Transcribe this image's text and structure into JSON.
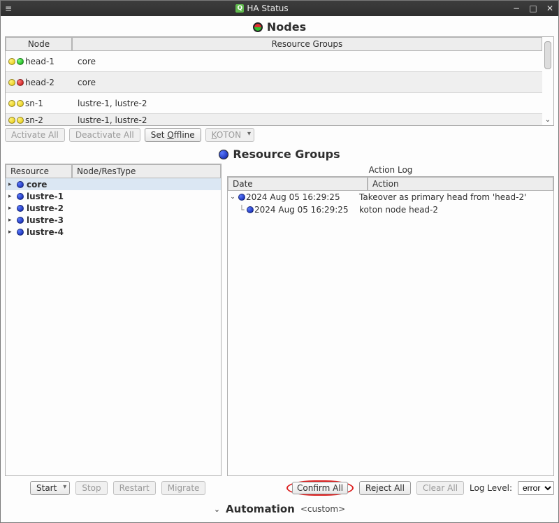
{
  "window": {
    "title": "HA Status",
    "app_icon_letter": "Q",
    "controls": {
      "minimize": "−",
      "maximize": "□",
      "close": "✕"
    }
  },
  "nodes_section": {
    "title": "Nodes",
    "columns": {
      "node": "Node",
      "rg": "Resource Groups"
    },
    "rows": [
      {
        "name": "head-1",
        "dot1": "yellow",
        "dot2": "green",
        "rg": "core"
      },
      {
        "name": "head-2",
        "dot1": "yellow",
        "dot2": "red",
        "rg": "core"
      },
      {
        "name": "sn-1",
        "dot1": "yellow",
        "dot2": "yellow",
        "rg": "lustre-1, lustre-2"
      },
      {
        "name": "sn-2",
        "dot1": "yellow",
        "dot2": "yellow",
        "rg": "lustre-1, lustre-2"
      }
    ],
    "buttons": {
      "activate_all": "Activate All",
      "deactivate_all": "Deactivate All",
      "set_offline_prefix": "Set ",
      "set_offline_underlined": "O",
      "set_offline_suffix": "ffline",
      "koton_underlined": "K",
      "koton_suffix": "OTON"
    }
  },
  "rg_section": {
    "title": "Resource Groups",
    "resource_header": {
      "resource": "Resource",
      "restype": "Node/ResType"
    },
    "resources": [
      {
        "name": "core"
      },
      {
        "name": "lustre-1"
      },
      {
        "name": "lustre-2"
      },
      {
        "name": "lustre-3"
      },
      {
        "name": "lustre-4"
      }
    ],
    "log_title": "Action Log",
    "log_header": {
      "date": "Date",
      "action": "Action"
    },
    "log_rows": [
      {
        "level": 0,
        "date": "2024 Aug 05 16:29:25",
        "action": "Takeover as primary head from 'head-2'"
      },
      {
        "level": 1,
        "date": "2024 Aug 05 16:29:25",
        "action": "koton node head-2"
      }
    ],
    "bottom": {
      "start": "Start",
      "stop": "Stop",
      "restart": "Restart",
      "migrate": "Migrate",
      "confirm_all": "Confirm All",
      "reject_all": "Reject All",
      "clear_all": "Clear All",
      "log_level_label": "Log Level:",
      "log_level_value": "error"
    }
  },
  "automation": {
    "label": "Automation",
    "custom": "<custom>"
  }
}
